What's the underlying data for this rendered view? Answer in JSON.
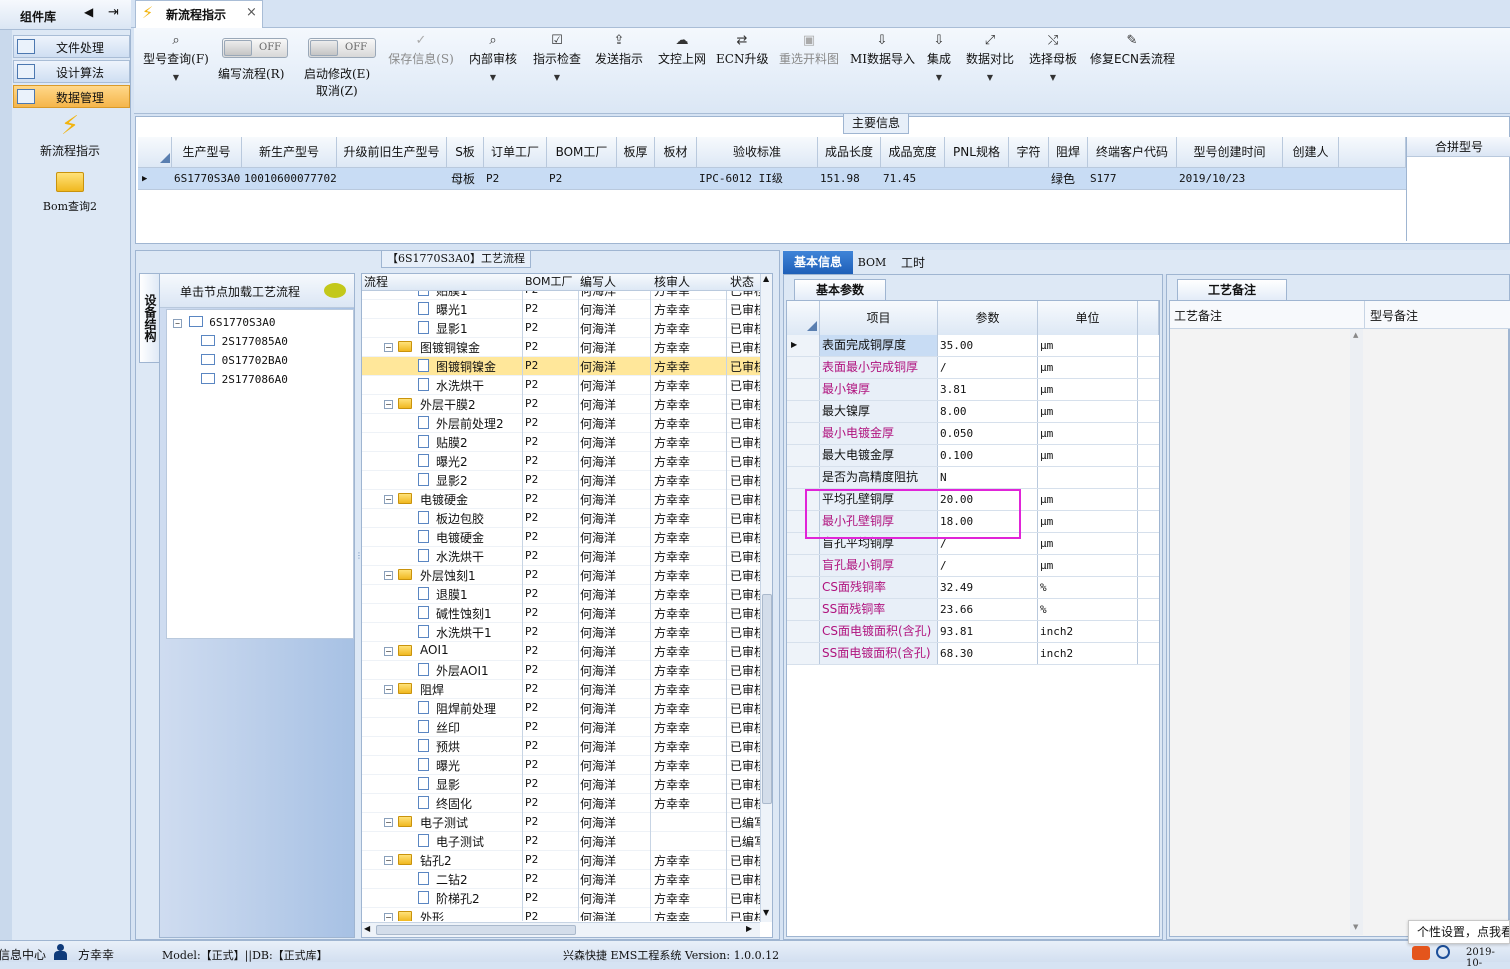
{
  "sidebar": {
    "title": "组件库",
    "items": [
      {
        "label": "文件处理"
      },
      {
        "label": "设计算法"
      },
      {
        "label": "数据管理"
      }
    ],
    "tools": [
      {
        "label": "新流程指示"
      },
      {
        "label": "Bom查询2"
      }
    ]
  },
  "doc_tab": {
    "title": "新流程指示",
    "close": "×"
  },
  "toolbar": {
    "model_query": "型号查询(F)",
    "edit_flow": "编写流程(R)",
    "edit_toggle": "OFF",
    "start_modify": "启动修改(E)",
    "cancel": "取消(Z)",
    "modify_toggle": "OFF",
    "buttons": [
      {
        "label": "保存信息(S)",
        "icon": "check-icon"
      },
      {
        "label": "内部审核",
        "icon": "search-icon"
      },
      {
        "label": "指示检查",
        "icon": "checkbox-icon"
      },
      {
        "label": "发送指示",
        "icon": "upload-icon"
      },
      {
        "label": "文控上网",
        "icon": "cloud-upload-icon"
      },
      {
        "label": "ECN升级",
        "icon": "arrows-icon"
      },
      {
        "label": "重选开料图",
        "icon": "image-icon"
      },
      {
        "label": "MI数据导入",
        "icon": "download-icon"
      },
      {
        "label": "集成",
        "icon": "download-icon"
      },
      {
        "label": "数据对比",
        "icon": "compare-icon"
      },
      {
        "label": "选择母板",
        "icon": "shuffle-icon"
      },
      {
        "label": "修复ECN丢流程",
        "icon": "wrench-icon"
      }
    ]
  },
  "main_info": {
    "title": "主要信息",
    "columns": [
      "生产型号",
      "新生产型号",
      "升级前旧生产型号",
      "S板",
      "订单工厂",
      "BOM工厂",
      "板厚",
      "板材",
      "验收标准",
      "成品长度",
      "成品宽度",
      "PNL规格",
      "字符",
      "阻焊",
      "终端客户代码",
      "型号创建时间",
      "创建人"
    ],
    "row": {
      "prod_no": "6S1770S3A0",
      "new_no": "10010600077702",
      "sboard": "母板",
      "order_factory": "P2",
      "bom_factory": "P2",
      "standard": "IPC-6012 II级",
      "length": "151.98",
      "width": "71.45",
      "solder": "绿色",
      "customer": "S177",
      "created": "2019/10/23"
    },
    "merge_title": "合拼型号"
  },
  "flow": {
    "title": "【6S1770S3A0】工艺流程",
    "side_tab": "设备结构",
    "load_hint": "单击节点加载工艺流程",
    "tree": [
      {
        "label": "6S1770S3A0",
        "children": [
          "2S177085A0",
          "0S17702BA0",
          "2S177086A0"
        ]
      }
    ],
    "columns": [
      "流程",
      "BOM工厂",
      "编写人",
      "核审人",
      "状态"
    ],
    "rows": [
      {
        "name": "贴膜1",
        "lvl": 2,
        "bom": "P2",
        "writer": "何海洋",
        "auditor": "方幸幸",
        "status": "已审核"
      },
      {
        "name": "曝光1",
        "lvl": 2,
        "bom": "P2",
        "writer": "何海洋",
        "auditor": "方幸幸",
        "status": "已审核"
      },
      {
        "name": "显影1",
        "lvl": 2,
        "bom": "P2",
        "writer": "何海洋",
        "auditor": "方幸幸",
        "status": "已审核"
      },
      {
        "name": "图镀铜镍金",
        "lvl": 1,
        "bom": "P2",
        "writer": "何海洋",
        "auditor": "方幸幸",
        "status": "已审核"
      },
      {
        "name": "图镀铜镍金",
        "lvl": 2,
        "bom": "P2",
        "writer": "何海洋",
        "auditor": "方幸幸",
        "status": "已审核",
        "sel": true
      },
      {
        "name": "水洗烘干",
        "lvl": 2,
        "bom": "P2",
        "writer": "何海洋",
        "auditor": "方幸幸",
        "status": "已审核"
      },
      {
        "name": "外层干膜2",
        "lvl": 1,
        "bom": "P2",
        "writer": "何海洋",
        "auditor": "方幸幸",
        "status": "已审核"
      },
      {
        "name": "外层前处理2",
        "lvl": 2,
        "bom": "P2",
        "writer": "何海洋",
        "auditor": "方幸幸",
        "status": "已审核"
      },
      {
        "name": "贴膜2",
        "lvl": 2,
        "bom": "P2",
        "writer": "何海洋",
        "auditor": "方幸幸",
        "status": "已审核"
      },
      {
        "name": "曝光2",
        "lvl": 2,
        "bom": "P2",
        "writer": "何海洋",
        "auditor": "方幸幸",
        "status": "已审核"
      },
      {
        "name": "显影2",
        "lvl": 2,
        "bom": "P2",
        "writer": "何海洋",
        "auditor": "方幸幸",
        "status": "已审核"
      },
      {
        "name": "电镀硬金",
        "lvl": 1,
        "bom": "P2",
        "writer": "何海洋",
        "auditor": "方幸幸",
        "status": "已审核"
      },
      {
        "name": "板边包胶",
        "lvl": 2,
        "bom": "P2",
        "writer": "何海洋",
        "auditor": "方幸幸",
        "status": "已审核"
      },
      {
        "name": "电镀硬金",
        "lvl": 2,
        "bom": "P2",
        "writer": "何海洋",
        "auditor": "方幸幸",
        "status": "已审核"
      },
      {
        "name": "水洗烘干",
        "lvl": 2,
        "bom": "P2",
        "writer": "何海洋",
        "auditor": "方幸幸",
        "status": "已审核"
      },
      {
        "name": "外层蚀刻1",
        "lvl": 1,
        "bom": "P2",
        "writer": "何海洋",
        "auditor": "方幸幸",
        "status": "已审核"
      },
      {
        "name": "退膜1",
        "lvl": 2,
        "bom": "P2",
        "writer": "何海洋",
        "auditor": "方幸幸",
        "status": "已审核"
      },
      {
        "name": "碱性蚀刻1",
        "lvl": 2,
        "bom": "P2",
        "writer": "何海洋",
        "auditor": "方幸幸",
        "status": "已审核"
      },
      {
        "name": "水洗烘干1",
        "lvl": 2,
        "bom": "P2",
        "writer": "何海洋",
        "auditor": "方幸幸",
        "status": "已审核"
      },
      {
        "name": "AOI1",
        "lvl": 1,
        "bom": "P2",
        "writer": "何海洋",
        "auditor": "方幸幸",
        "status": "已审核"
      },
      {
        "name": "外层AOI1",
        "lvl": 2,
        "bom": "P2",
        "writer": "何海洋",
        "auditor": "方幸幸",
        "status": "已审核"
      },
      {
        "name": "阻焊",
        "lvl": 1,
        "bom": "P2",
        "writer": "何海洋",
        "auditor": "方幸幸",
        "status": "已审核"
      },
      {
        "name": "阻焊前处理",
        "lvl": 2,
        "bom": "P2",
        "writer": "何海洋",
        "auditor": "方幸幸",
        "status": "已审核"
      },
      {
        "name": "丝印",
        "lvl": 2,
        "bom": "P2",
        "writer": "何海洋",
        "auditor": "方幸幸",
        "status": "已审核"
      },
      {
        "name": "预烘",
        "lvl": 2,
        "bom": "P2",
        "writer": "何海洋",
        "auditor": "方幸幸",
        "status": "已审核"
      },
      {
        "name": "曝光",
        "lvl": 2,
        "bom": "P2",
        "writer": "何海洋",
        "auditor": "方幸幸",
        "status": "已审核"
      },
      {
        "name": "显影",
        "lvl": 2,
        "bom": "P2",
        "writer": "何海洋",
        "auditor": "方幸幸",
        "status": "已审核"
      },
      {
        "name": "终固化",
        "lvl": 2,
        "bom": "P2",
        "writer": "何海洋",
        "auditor": "方幸幸",
        "status": "已审核"
      },
      {
        "name": "电子测试",
        "lvl": 1,
        "bom": "P2",
        "writer": "何海洋",
        "auditor": "",
        "status": "已编写"
      },
      {
        "name": "电子测试",
        "lvl": 2,
        "bom": "P2",
        "writer": "何海洋",
        "auditor": "",
        "status": "已编写"
      },
      {
        "name": "钻孔2",
        "lvl": 1,
        "bom": "P2",
        "writer": "何海洋",
        "auditor": "方幸幸",
        "status": "已审核"
      },
      {
        "name": "二钻2",
        "lvl": 2,
        "bom": "P2",
        "writer": "何海洋",
        "auditor": "方幸幸",
        "status": "已审核"
      },
      {
        "name": "阶梯孔2",
        "lvl": 2,
        "bom": "P2",
        "writer": "何海洋",
        "auditor": "方幸幸",
        "status": "已审核"
      },
      {
        "name": "外形",
        "lvl": 1,
        "bom": "P2",
        "writer": "何海洋",
        "auditor": "方幸幸",
        "status": "已审核"
      }
    ]
  },
  "detail_tabs": [
    {
      "label": "基本信息",
      "active": true
    },
    {
      "label": "BOM"
    },
    {
      "label": "工时"
    }
  ],
  "params": {
    "title": "基本参数",
    "columns": [
      "项目",
      "参数",
      "单位"
    ],
    "rows": [
      {
        "item": "表面完成铜厚度",
        "value": "35.00",
        "unit": "μm",
        "pink": false
      },
      {
        "item": "表面最小完成铜厚",
        "value": "/",
        "unit": "μm",
        "pink": true
      },
      {
        "item": "最小镍厚",
        "value": "3.81",
        "unit": "μm",
        "pink": true
      },
      {
        "item": "最大镍厚",
        "value": "8.00",
        "unit": "μm",
        "pink": false
      },
      {
        "item": "最小电镀金厚",
        "value": "0.050",
        "unit": "μm",
        "pink": true
      },
      {
        "item": "最大电镀金厚",
        "value": "0.100",
        "unit": "μm",
        "pink": false
      },
      {
        "item": "是否为高精度阻抗",
        "value": "N",
        "unit": "",
        "pink": false
      },
      {
        "item": "平均孔壁铜厚",
        "value": "20.00",
        "unit": "μm",
        "pink": false
      },
      {
        "item": "最小孔壁铜厚",
        "value": "18.00",
        "unit": "μm",
        "pink": true
      },
      {
        "item": "盲孔平均铜厚",
        "value": "/",
        "unit": "μm",
        "pink": false
      },
      {
        "item": "盲孔最小铜厚",
        "value": "/",
        "unit": "μm",
        "pink": true
      },
      {
        "item": "CS面残铜率",
        "value": "32.49",
        "unit": "%",
        "pink": true
      },
      {
        "item": "SS面残铜率",
        "value": "23.66",
        "unit": "%",
        "pink": true
      },
      {
        "item": "CS面电镀面积(含孔)",
        "value": "93.81",
        "unit": "inch2",
        "pink": true
      },
      {
        "item": "SS面电镀面积(含孔)",
        "value": "68.30",
        "unit": "inch2",
        "pink": true
      }
    ]
  },
  "remarks": {
    "title": "工艺备注",
    "col1": "工艺备注",
    "col2": "型号备注"
  },
  "status": {
    "info_center": "信息中心",
    "user": "方幸幸",
    "model": "Model:【正式】||DB:【正式库】",
    "system": "兴森快捷  EMS工程系统  Version: 1.0.0.12",
    "tooltip": "个性设置，点我看",
    "date": "2019-10-"
  }
}
